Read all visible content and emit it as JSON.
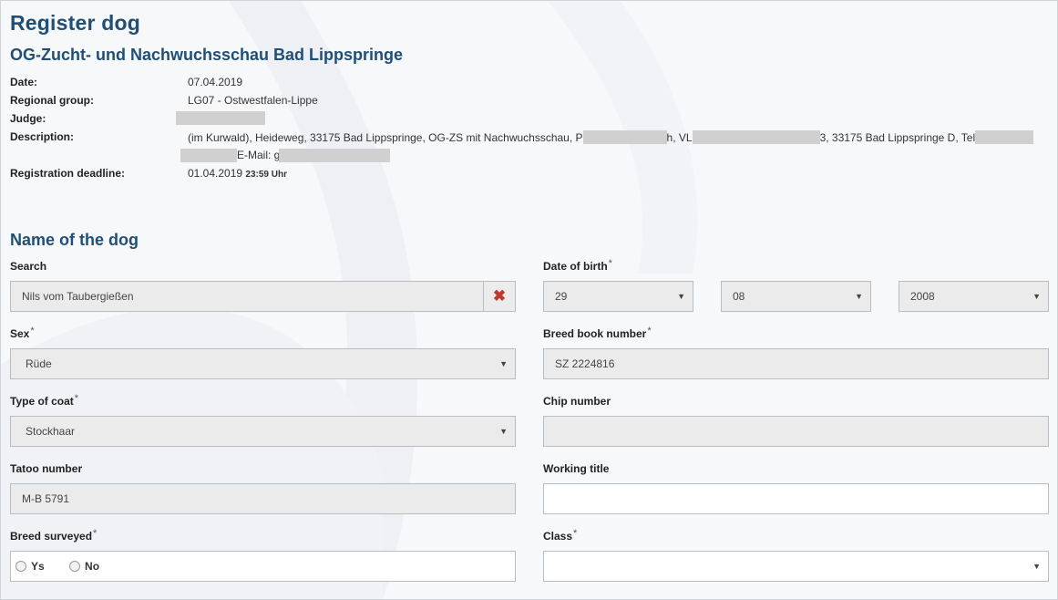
{
  "page_title": "Register dog",
  "event_name": "OG-Zucht- und Nachwuchsschau Bad Lippspringe",
  "info": {
    "date_label": "Date:",
    "date_value": "07.04.2019",
    "regional_group_label": "Regional group:",
    "regional_group_value": "LG07 - Ostwestfalen-Lippe",
    "judge_label": "Judge:",
    "description_label": "Description:",
    "description_seg1": "(im Kurwald), Heideweg, 33175 Bad Lippspringe, OG-ZS mit Nachwuchsschau, P",
    "description_seg2": "h, VL",
    "description_seg3": "3, 33175 Bad Lippspringe D, Tel",
    "description_line2_email": "E-Mail: g",
    "deadline_label": "Registration deadline:",
    "deadline_date": "01.04.2019",
    "deadline_time": "23:59 Uhr"
  },
  "section_title": "Name of the dog",
  "form": {
    "search_label": "Search",
    "search_value": "Nils vom Taubergießen",
    "clear_symbol": "✖",
    "dob_label": "Date of birth",
    "dob_day": "29",
    "dob_month": "08",
    "dob_year": "2008",
    "sex_label": "Sex",
    "sex_value": "Rüde",
    "breed_book_label": "Breed book number",
    "breed_book_value": "SZ 2224816",
    "coat_label": "Type of coat",
    "coat_value": "Stockhaar",
    "chip_label": "Chip number",
    "chip_value": "",
    "tatoo_label": "Tatoo number",
    "tatoo_value": "M-B 5791",
    "working_title_label": "Working title",
    "working_title_value": "",
    "breed_surveyed_label": "Breed surveyed",
    "yes_label": "Ys",
    "no_label": "No",
    "class_label": "Class",
    "class_value": "",
    "required_mark": "*",
    "dropdown_arrow": "▼"
  }
}
